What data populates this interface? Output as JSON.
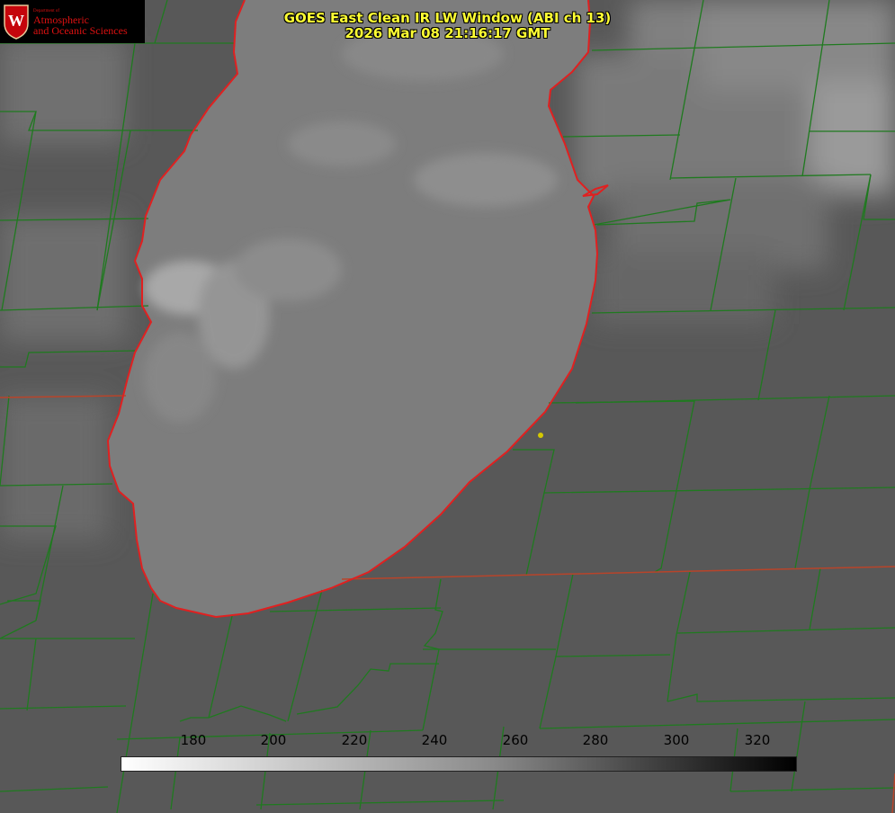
{
  "title": {
    "line1": "GOES East Clean IR LW Window (ABI ch 13)",
    "line2": "2026 Mar 08 21:16:17 GMT"
  },
  "logo": {
    "dept_label": "Department of",
    "line1": "Atmospheric",
    "line2": "and Oceanic Sciences",
    "crest_letter": "W",
    "icon": "uw-crest-icon"
  },
  "colorbar": {
    "labels": [
      "180",
      "200",
      "220",
      "240",
      "260",
      "280",
      "300",
      "320"
    ],
    "gradient": [
      "#ffffff",
      "#000000"
    ]
  },
  "colors": {
    "background": "#5c5c5c",
    "lake": "#7f7f7f",
    "shoreline": "#e02020",
    "county_lines": "#1f7a1f",
    "state_line": "#b8442a",
    "title_text": "#ffff33",
    "marker": "#d4c800"
  }
}
